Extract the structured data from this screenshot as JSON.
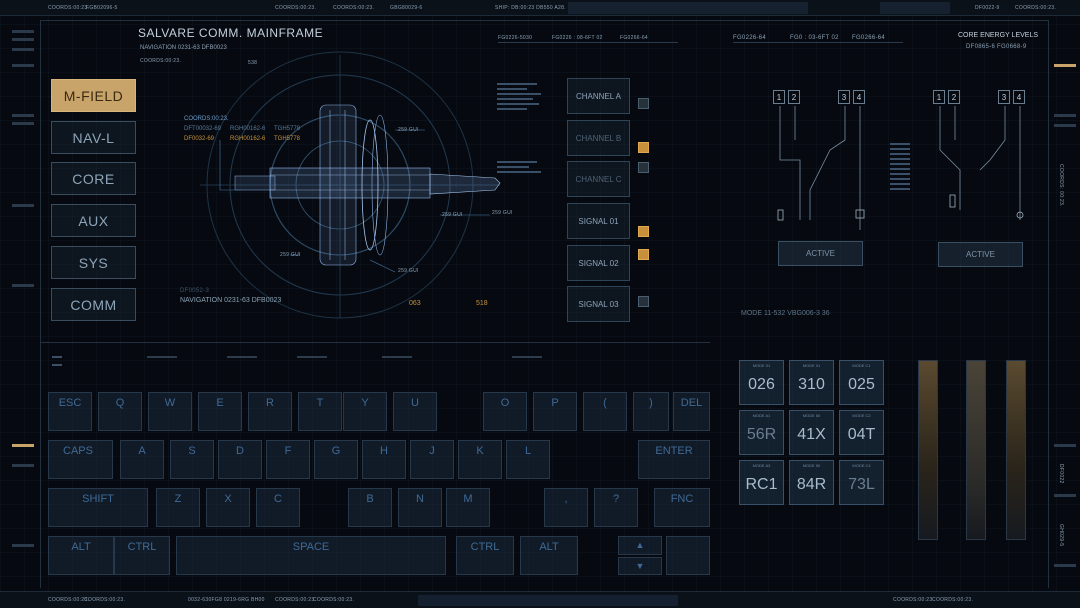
{
  "header": {
    "title": "SALVARE COMM. MAINFRAME",
    "nav_code": "NAVIGATION 0231-63  DFB0023",
    "coords_small": "COORDS:00:23.",
    "top_strip": [
      "COORDS:00:23.",
      "FGB02096-5",
      "COORDS:00:23.",
      "COORDS:00:23.",
      "GBG80029-6",
      "SHIP: DB:00:23  DB550  A28.",
      "DF0022-9",
      "COORDS:00:23."
    ],
    "fg_codes": [
      "FG0226-64",
      "FG0 : 03-6FT  02",
      "FG0266-64"
    ],
    "mid_codes": [
      "FG0226-5030",
      "FG0226 : 08-6FT  02",
      "FG0266-64"
    ],
    "core_energy": "CORE ENERGY LEVELS",
    "core_codes": "DF0865-6  FG0668-9"
  },
  "menu": {
    "items": [
      {
        "label": "M-FIELD",
        "active": true
      },
      {
        "label": "NAV-L",
        "active": false
      },
      {
        "label": "CORE",
        "active": false
      },
      {
        "label": "AUX",
        "active": false
      },
      {
        "label": "SYS",
        "active": false
      },
      {
        "label": "COMM",
        "active": false
      }
    ]
  },
  "ship_view": {
    "coords": "COORDS:00:23.",
    "code_a": "DFT00032-69",
    "code_b": "RGH00162-6",
    "code_c": "TGH5778",
    "code_d": "DF0032-69",
    "code_e": "RGH00162-6",
    "code_f": "TGH5778",
    "bearing_top": "538",
    "bearing_b1": "063",
    "bearing_b2": "518",
    "nav_sub": "DF0052-3",
    "nav_line": "NAVIGATION 0231-63   DFB0023",
    "gui_labels": [
      "259 GUI",
      "259 GUI",
      "259 GUI",
      "259 GUI",
      "259 GUI"
    ]
  },
  "channels": {
    "items": [
      {
        "label": "CHANNEL A",
        "dim": false,
        "check": "off"
      },
      {
        "label": "CHANNEL B",
        "dim": true,
        "check": "on"
      },
      {
        "label": "CHANNEL C",
        "dim": true,
        "check": "off"
      },
      {
        "label": "SIGNAL 01",
        "dim": false,
        "check": "on"
      },
      {
        "label": "SIGNAL 02",
        "dim": false,
        "check": "on"
      },
      {
        "label": "SIGNAL 03",
        "dim": false,
        "check": "off"
      }
    ]
  },
  "circuits": {
    "left_nums": [
      "1",
      "2",
      "3",
      "4"
    ],
    "right_nums": [
      "1",
      "2",
      "3",
      "4"
    ],
    "active_left": "ACTIVE",
    "active_right": "ACTIVE"
  },
  "modes": {
    "line": "MODE 11-532    VBG006-3  36",
    "cells": [
      {
        "label": "MODE 01",
        "value": "026",
        "dim": false
      },
      {
        "label": "MODE 01",
        "value": "310",
        "dim": false
      },
      {
        "label": "MODE C1",
        "value": "025",
        "dim": false
      },
      {
        "label": "MODE A1",
        "value": "56R",
        "dim": true
      },
      {
        "label": "MODE 60",
        "value": "41X",
        "dim": false
      },
      {
        "label": "MODE C2",
        "value": "04T",
        "dim": false
      },
      {
        "label": "MODE A3",
        "value": "RC1",
        "dim": false
      },
      {
        "label": "MODE 50",
        "value": "84R",
        "dim": false
      },
      {
        "label": "MODE C4",
        "value": "73L",
        "dim": true
      }
    ]
  },
  "keyboard": {
    "row1": [
      "ESC",
      "Q",
      "W",
      "E",
      "R",
      "T",
      "Y",
      "U",
      "O",
      "P",
      "(",
      ")",
      "DEL"
    ],
    "row2": [
      "CAPS",
      "A",
      "S",
      "D",
      "F",
      "G",
      "H",
      "J",
      "K",
      "L",
      "ENTER"
    ],
    "row3": [
      "SHIFT",
      "Z",
      "X",
      "C",
      "B",
      "N",
      "M",
      ",",
      "?",
      "FNC"
    ],
    "row4": [
      "ALT",
      "CTRL",
      "SPACE",
      "CTRL",
      "ALT",
      "▲",
      "▼"
    ]
  },
  "footer": {
    "strip": [
      "COORDS:00:23.",
      "COORDS:00:23.",
      "0032-630FG8   0219-6RG   BH00",
      "COORDS:00:23.",
      "COORDS:00:23.",
      "COORDS:00:23.",
      "COORDS:00:23."
    ]
  },
  "right_rail": {
    "v1": "COORDS: 00:23.",
    "v2": "DF0022",
    "v3": "GH029-5"
  },
  "colors": {
    "accent_gold": "#c8a46a",
    "check_on": "#c8903a",
    "panel_line": "#3a4d5e"
  }
}
